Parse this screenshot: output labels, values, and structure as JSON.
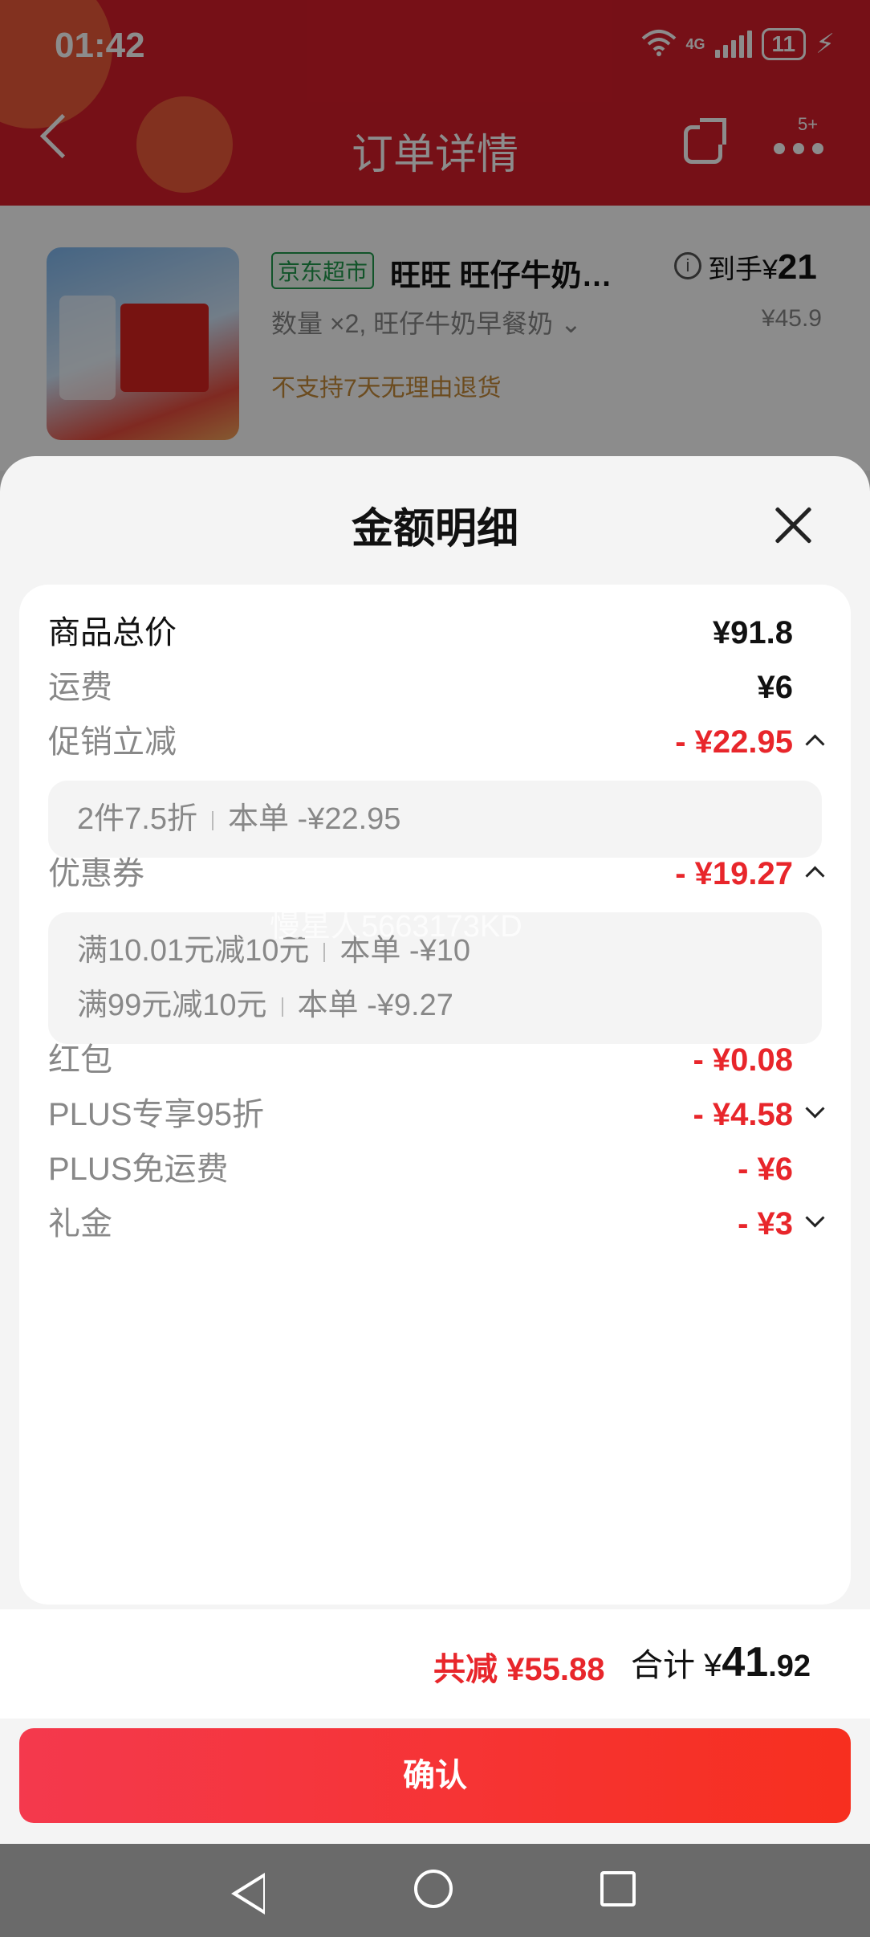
{
  "status_bar": {
    "time": "01:42",
    "network": "4G",
    "battery": "11"
  },
  "nav": {
    "title": "订单详情",
    "badge": "5+"
  },
  "product": {
    "store_tag": "京东超市",
    "name": "旺旺 旺仔牛奶…",
    "final_label": "到手¥",
    "final_price": "21",
    "spec": "数量 ×2, 旺仔牛奶早餐奶 ⌄",
    "price": "¥45.9",
    "note": "不支持7天无理由退货"
  },
  "sheet": {
    "title": "金额明细",
    "rows": {
      "goods_total": {
        "label": "商品总价",
        "value": "¥91.8"
      },
      "shipping": {
        "label": "运费",
        "value": "¥6"
      },
      "promo": {
        "label": "促销立减",
        "value": "- ¥22.95"
      },
      "coupon": {
        "label": "优惠券",
        "value": "- ¥19.27"
      },
      "red_packet": {
        "label": "红包",
        "value": "- ¥0.08"
      },
      "plus_discount": {
        "label": "PLUS专享95折",
        "value": "- ¥4.58"
      },
      "plus_shipping": {
        "label": "PLUS免运费",
        "value": "- ¥6"
      },
      "gift": {
        "label": "礼金",
        "value": "- ¥3"
      }
    },
    "promo_details": [
      {
        "rule": "2件7.5折",
        "amount": "本单 -¥22.95"
      }
    ],
    "coupon_details": [
      {
        "rule": "满10.01元减10元",
        "amount": "本单 -¥10"
      },
      {
        "rule": "满99元减10元",
        "amount": "本单 -¥9.27"
      }
    ],
    "watermark": "慢星人5663173KD",
    "total": {
      "reduced": "共减 ¥55.88",
      "sum_label": "合计 ¥",
      "sum_int": "41",
      "sum_dec": ".92"
    },
    "confirm_label": "确认"
  },
  "colors": {
    "accent": "#e8262b",
    "header": "#d81e2a",
    "store_tag": "#1f9a4c"
  },
  "icons": [
    "wifi-icon",
    "signal-icon",
    "battery-icon",
    "back-icon",
    "share-icon",
    "more-icon",
    "info-icon",
    "close-icon",
    "chevron-up-icon",
    "chevron-down-icon"
  ]
}
